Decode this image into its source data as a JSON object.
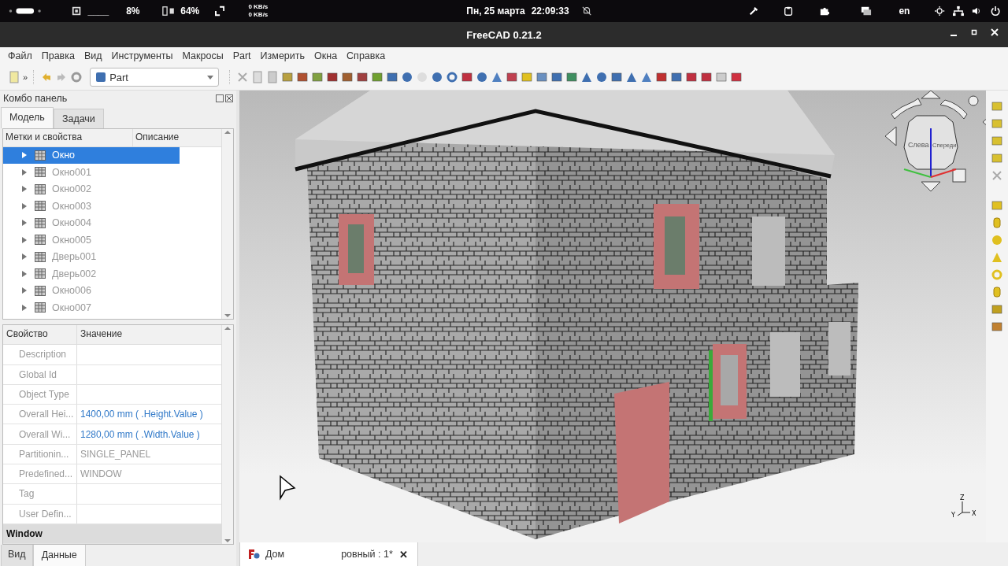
{
  "status_bar": {
    "cpu_graph": "____",
    "cpu": "8%",
    "memory": "64%",
    "net_up": "0 KB/s",
    "net_down": "0 KB/s",
    "date": "Пн, 25 марта",
    "time": "22:09:33",
    "language": "en"
  },
  "window": {
    "title": "FreeCAD 0.21.2"
  },
  "menu": [
    "Файл",
    "Правка",
    "Вид",
    "Инструменты",
    "Макросы",
    "Part",
    "Измерить",
    "Окна",
    "Справка"
  ],
  "toolbar": {
    "workbench": "Part",
    "overflow": "»"
  },
  "combo_panel": {
    "title": "Комбо панель",
    "tabs": [
      {
        "label": "Модель",
        "selected": true
      },
      {
        "label": "Задачи",
        "selected": false
      }
    ],
    "tree": {
      "columns": [
        "Метки и свойства",
        "Описание"
      ],
      "items": [
        {
          "label": "Окно",
          "selected": true
        },
        {
          "label": "Окно001",
          "selected": false
        },
        {
          "label": "Окно002",
          "selected": false
        },
        {
          "label": "Окно003",
          "selected": false
        },
        {
          "label": "Окно004",
          "selected": false
        },
        {
          "label": "Окно005",
          "selected": false
        },
        {
          "label": "Дверь001",
          "selected": false
        },
        {
          "label": "Дверь002",
          "selected": false
        },
        {
          "label": "Окно006",
          "selected": false
        },
        {
          "label": "Окно007",
          "selected": false
        }
      ]
    },
    "properties": {
      "columns": [
        "Свойство",
        "Значение"
      ],
      "rows": [
        {
          "kind": "plain",
          "name": "Description"
        },
        {
          "kind": "plain",
          "name": "Global Id"
        },
        {
          "kind": "plain",
          "name": "Object Type"
        },
        {
          "kind": "expression",
          "name": "Overall Hei...",
          "value": "1400,00 mm  ( .Height.Value )"
        },
        {
          "kind": "expression",
          "name": "Overall Wi...",
          "value": "1280,00 mm  ( .Width.Value )"
        },
        {
          "kind": "plain",
          "name": "Partitionin...",
          "value": "SINGLE_PANEL"
        },
        {
          "kind": "plain",
          "name": "Predefined...",
          "value": "WINDOW"
        },
        {
          "kind": "plain",
          "name": "Tag"
        },
        {
          "kind": "plain",
          "name": "User Defin..."
        },
        {
          "kind": "group",
          "name": "Window"
        }
      ]
    },
    "bottom_tabs": [
      {
        "label": "Вид",
        "selected": false
      },
      {
        "label": "Данные",
        "selected": true
      }
    ]
  },
  "view": {
    "nav_cube": {
      "left": "Слева",
      "front": "Спереди"
    },
    "axes": [
      "Z",
      "Y",
      "X"
    ]
  },
  "document_tab": {
    "name_start": "Дом",
    "name_end": "ровный : 1*",
    "close": "✕"
  }
}
